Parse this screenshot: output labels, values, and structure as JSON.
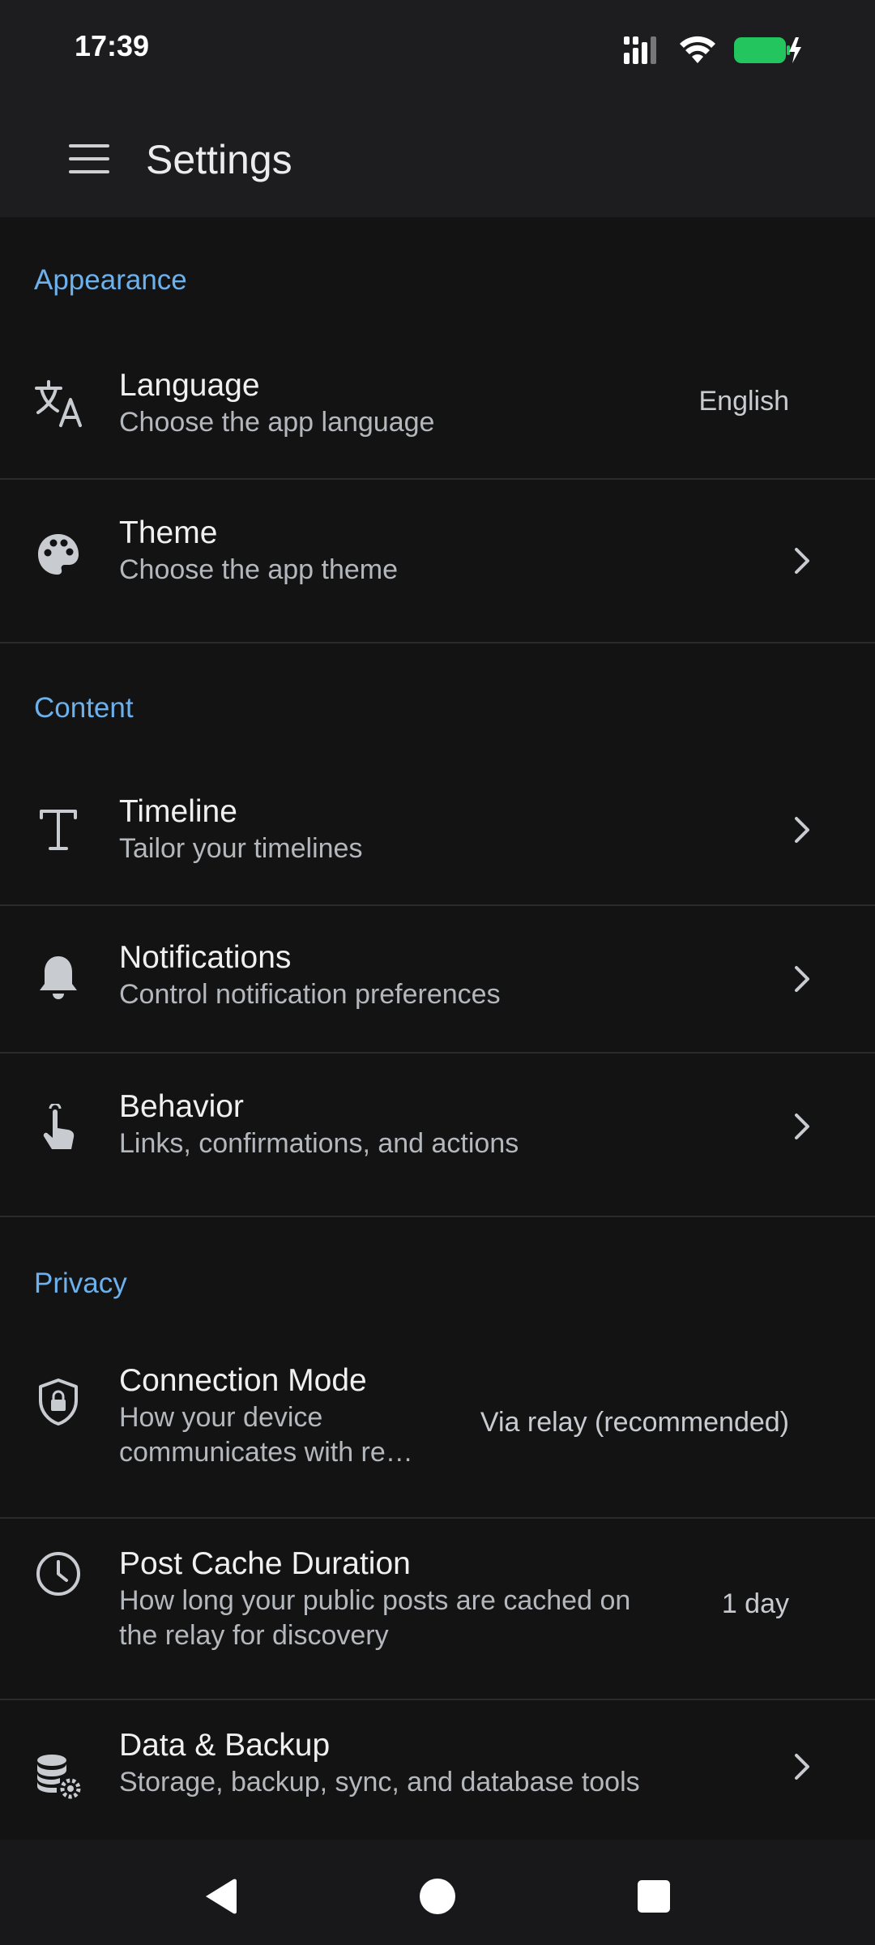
{
  "status_bar": {
    "time": "17:39"
  },
  "app_bar": {
    "title": "Settings"
  },
  "sections": [
    {
      "header": "Appearance",
      "items": [
        {
          "title": "Language",
          "subtitle": "Choose the app language",
          "value": "English",
          "icon": "translate-icon"
        },
        {
          "title": "Theme",
          "subtitle": "Choose the app theme",
          "icon": "palette-icon"
        }
      ]
    },
    {
      "header": "Content",
      "items": [
        {
          "title": "Timeline",
          "subtitle": "Tailor your timelines",
          "icon": "text-t-icon"
        },
        {
          "title": "Notifications",
          "subtitle": "Control notification preferences",
          "icon": "bell-icon"
        },
        {
          "title": "Behavior",
          "subtitle": "Links, confirmations, and actions",
          "icon": "touch-hand-icon"
        }
      ]
    },
    {
      "header": "Privacy",
      "items": [
        {
          "title": "Connection Mode",
          "subtitle_line1": "How your device",
          "subtitle_line2": "communicates with re…",
          "value": "Via relay (recommended)",
          "icon": "shield-lock-icon"
        },
        {
          "title": "Post Cache Duration",
          "subtitle_line1": "How long your public posts are cached on",
          "subtitle_line2": "the relay for discovery",
          "value": "1 day",
          "icon": "clock-icon"
        },
        {
          "title": "Data & Backup",
          "subtitle": "Storage, backup, sync, and database tools",
          "icon": "database-gear-icon"
        }
      ]
    }
  ],
  "colors": {
    "accent": "#6cb0ec",
    "battery": "#22c55e",
    "background": "#131314",
    "bar": "#1d1d1f"
  }
}
